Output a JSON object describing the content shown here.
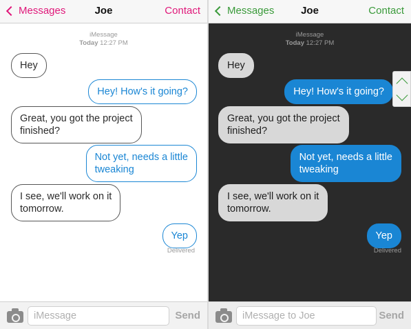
{
  "light": {
    "nav": {
      "back_label": "Messages",
      "title": "Joe",
      "contact_label": "Contact"
    },
    "meta": {
      "service": "iMessage",
      "day": "Today",
      "time": "12:27 PM"
    },
    "messages": [
      {
        "direction": "in",
        "text": "Hey"
      },
      {
        "direction": "out",
        "text": "Hey! How's it going?"
      },
      {
        "direction": "in",
        "text_line1": "Great, you got the project",
        "text_line2": "finished?"
      },
      {
        "direction": "out",
        "text_line1": "Not yet, needs a little",
        "text_line2": "tweaking"
      },
      {
        "direction": "in",
        "text_line1": "I see, we'll work on it",
        "text_line2": "tomorrow."
      },
      {
        "direction": "out",
        "text": "Yep"
      }
    ],
    "delivered": "Delivered",
    "input": {
      "placeholder": "iMessage",
      "send_label": "Send"
    },
    "accent": "#e0187a"
  },
  "dark": {
    "nav": {
      "back_label": "Messages",
      "title": "Joe",
      "contact_label": "Contact"
    },
    "meta": {
      "service": "iMessage",
      "day": "Today",
      "time": "12:27 PM"
    },
    "messages": [
      {
        "direction": "in",
        "text": "Hey"
      },
      {
        "direction": "out",
        "text": "Hey! How's it going?"
      },
      {
        "direction": "in",
        "text_line1": "Great, you got the project",
        "text_line2": "finished?"
      },
      {
        "direction": "out",
        "text_line1": "Not yet, needs a little",
        "text_line2": "tweaking"
      },
      {
        "direction": "in",
        "text_line1": "I see, we'll work on it",
        "text_line2": "tomorrow."
      },
      {
        "direction": "out",
        "text": "Yep"
      }
    ],
    "delivered": "Delivered",
    "input": {
      "placeholder": "iMessage to Joe",
      "send_label": "Send"
    },
    "accent": "#3a9a3a",
    "scroll_icons": [
      "chevron-up-icon",
      "chevron-down-icon"
    ]
  }
}
